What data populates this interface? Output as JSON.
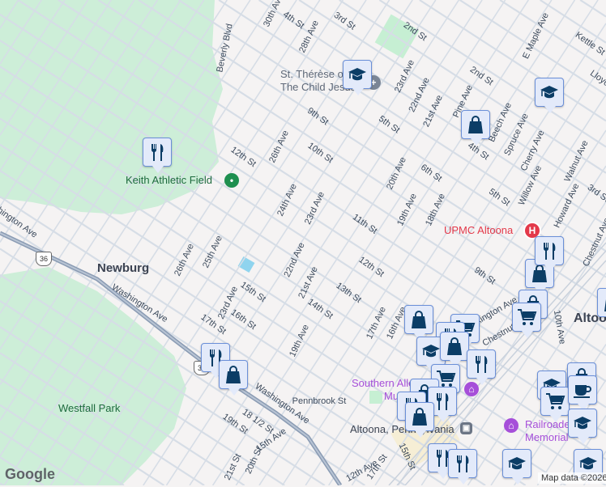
{
  "map": {
    "colors": {
      "background": "#f5f3f3",
      "park": "#cdeed8",
      "road": "#d6dde6",
      "highway": "#8a9bb3",
      "marker_bg": "#e3eafa",
      "marker_icon": "#0b3d66",
      "hospital": "#e3394a",
      "museum": "#a64fd9"
    },
    "places": {
      "neighborhood_newburg": "Newburg",
      "city_altoona": "Altoona",
      "keith_field": "Keith Athletic Field",
      "westfall_park": "Westfall Park",
      "st_therese_1": "St. Thérèse of",
      "st_therese_2": "The Child Jesus",
      "upmc": "UPMC Altoona",
      "museum_1": "Southern Allegheny",
      "museum_2": "Museum",
      "station": "Altoona, Pennsylvania",
      "railroad_1": "Railroaders",
      "railroad_2": "Memorial"
    },
    "streets": [
      "30th Ave",
      "4th St",
      "28th Ave",
      "3rd St",
      "2nd St",
      "Beverly Blvd",
      "23rd Ave",
      "22nd Ave",
      "21st Ave",
      "Pine Ave",
      "Beech Ave",
      "Spruce Ave",
      "Cherry Ave",
      "Walnut Ave",
      "E Maple Ave",
      "Kettle St",
      "Lloyd",
      "2nd St",
      "9th St",
      "5th St",
      "10th St",
      "26th Ave",
      "12th St",
      "4th St",
      "6th St",
      "5th St",
      "20th Ave",
      "19th Ave",
      "18th Ave",
      "Willow Ave",
      "Howard Ave",
      "3rd St",
      "24th Ave",
      "23rd Ave",
      "11th St",
      "Chestnut Ave",
      "Washington Ave",
      "26th Ave",
      "25th Ave",
      "22nd Ave",
      "21st Ave",
      "12th St",
      "9th St",
      "Washington Ave",
      "15th St",
      "23rd Ave",
      "16th St",
      "17th St",
      "13th St",
      "14th St",
      "17th Ave",
      "16th Ave",
      "19th Ave",
      "Lexington Ave",
      "Chestnut Ave",
      "10th Ave",
      "Pennbrook St",
      "Washington Ave",
      "19th St",
      "18 1/2 St",
      "15th Ave",
      "20th St",
      "21st St",
      "15th St",
      "12th Ave",
      "17th St"
    ],
    "route_shields": [
      "36",
      "36"
    ],
    "markers": [
      "graduation-cap",
      "graduation-cap",
      "shopping-bag",
      "fork-knife",
      "shopping-bag",
      "fork-knife",
      "shopping-bag",
      "shopping-cart",
      "shopping-bag",
      "shopping-cart",
      "fork-knife",
      "graduation-cap",
      "shopping-bag",
      "fork-knife",
      "shopping-cart",
      "shopping-bag",
      "shopping-bag",
      "fork-knife",
      "fork-knife",
      "shopping-bag",
      "graduation-cap",
      "shopping-cart",
      "coffee-cup",
      "graduation-cap"
    ],
    "attribution": "Map data ©2026",
    "logo": "Google"
  }
}
